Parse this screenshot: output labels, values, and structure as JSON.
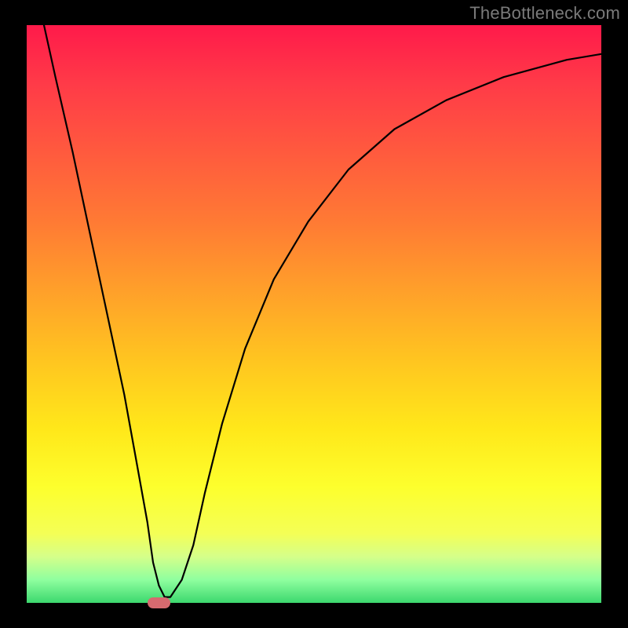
{
  "watermark": "TheBottleneck.com",
  "chart_data": {
    "type": "line",
    "title": "",
    "xlabel": "",
    "ylabel": "",
    "xlim": [
      0,
      100
    ],
    "ylim": [
      0,
      100
    ],
    "background_gradient": {
      "top": "#ff1a4a",
      "mid_upper": "#ff7a34",
      "mid": "#ffe81a",
      "bottom": "#3cd86e",
      "meaning": "red = high bottleneck, green = low bottleneck"
    },
    "series": [
      {
        "name": "bottleneck-curve",
        "color": "#000000",
        "x": [
          3,
          5,
          8,
          11,
          14,
          17,
          19,
          21,
          22,
          23,
          24,
          25,
          27,
          29,
          31,
          34,
          38,
          43,
          49,
          56,
          64,
          73,
          83,
          94,
          100
        ],
        "y": [
          100,
          91,
          78,
          64,
          50,
          36,
          25,
          14,
          7,
          3,
          1,
          1,
          4,
          10,
          19,
          31,
          44,
          56,
          66,
          75,
          82,
          87,
          91,
          94,
          95
        ]
      }
    ],
    "marker": {
      "name": "optimal-point",
      "shape": "pill",
      "color": "#d66a6f",
      "x": 23,
      "y": 0,
      "width_pct": 4,
      "height_pct": 2
    },
    "legend": null,
    "grid": false
  }
}
